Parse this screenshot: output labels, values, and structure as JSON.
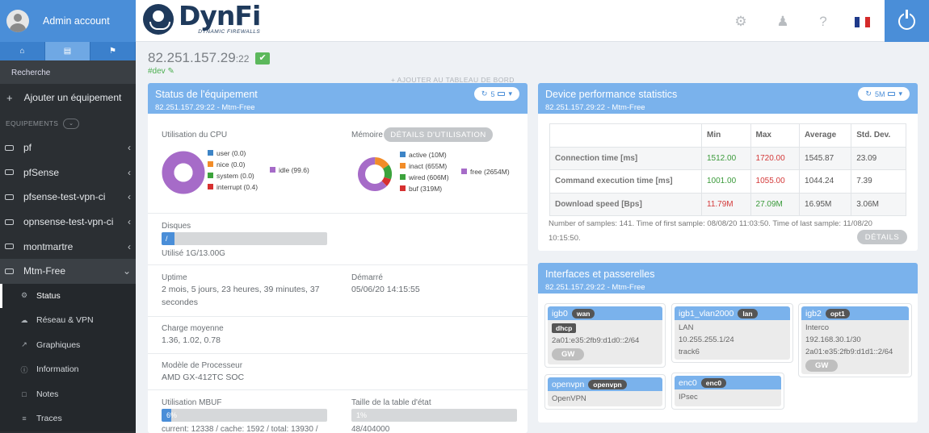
{
  "sidebar": {
    "user": "Admin account",
    "search": "Recherche",
    "add_label": "Ajouter un équipement",
    "section": "EQUIPEMENTS",
    "devices": [
      "pf",
      "pfSense",
      "pfsense-test-vpn-ci",
      "opnsense-test-vpn-ci",
      "montmartre",
      "Mtm-Free"
    ],
    "subitems": [
      "Status",
      "Réseau & VPN",
      "Graphiques",
      "Information",
      "Notes",
      "Traces"
    ]
  },
  "header": {
    "logo": "DynFi",
    "logo_sub": "DYNAMIC FIREWALLS",
    "flag_colors": [
      "#1f3a8a",
      "#ffffff",
      "#d42a2a"
    ]
  },
  "main": {
    "ip": "82.251.157.29",
    "port": ":22",
    "tag": "#dev",
    "add_dashboard": "+ AJOUTER AU TABLEAU DE BORD"
  },
  "status": {
    "title": "Status de l'équipement",
    "subtitle": "82.251.157.29:22 - Mtm-Free",
    "btn": "5",
    "cpu_label": "Utilisation du CPU",
    "cpu_legend": [
      "user (0.0)",
      "nice (0.0)",
      "system (0.0)",
      "interrupt (0.4)"
    ],
    "cpu_idle": "idle (99.6)",
    "mem_label": "Mémoire",
    "mem_btn": "DÉTAILS D'UTILISATION",
    "mem_legend": [
      "active (10M)",
      "inact (655M)",
      "wired (606M)",
      "buf (319M)"
    ],
    "mem_free": "free (2654M)",
    "disk_label": "Disques",
    "disk_bar": "/",
    "disk_used": "Utilisé 1G/13.00G",
    "disk_percent": 8,
    "uptime_label": "Uptime",
    "uptime_value": "2 mois, 5 jours, 23 heures, 39 minutes, 37 secondes",
    "started_label": "Démarré",
    "started_value": "05/06/20 14:15:55",
    "load_label": "Charge moyenne",
    "load_value": "1.36, 1.02, 0.78",
    "cpu_model_label": "Modèle de Processeur",
    "cpu_model_value": "AMD GX-412TC SOC",
    "mbuf_label": "Utilisation MBUF",
    "mbuf_bar": "6%",
    "mbuf_percent": 6,
    "mbuf_value": "current: 12338 / cache: 1592 / total: 13930 /",
    "state_label": "Taille de la table d'état",
    "state_bar": "1%",
    "state_value": "48/404000"
  },
  "perf": {
    "title": "Device performance statistics",
    "subtitle": "82.251.157.29:22 - Mtm-Free",
    "btn": "5M",
    "headers": [
      "",
      "Min",
      "Max",
      "Average",
      "Std. Dev."
    ],
    "rows": [
      [
        "Connection time [ms]",
        "1512.00",
        "1720.00",
        "1545.87",
        "23.09"
      ],
      [
        "Command execution time [ms]",
        "1001.00",
        "1055.00",
        "1044.24",
        "7.39"
      ],
      [
        "Download speed [Bps]",
        "11.79M",
        "27.09M",
        "16.95M",
        "3.06M"
      ]
    ],
    "note": "Number of samples: 141. Time of first sample: 08/08/20 11:03:50. Time of last sample: 11/08/20 10:15:50.",
    "details_btn": "DÉTAILS"
  },
  "ifaces": {
    "title": "Interfaces et passerelles",
    "subtitle": "82.251.157.29:22 - Mtm-Free",
    "cards": {
      "igb0": {
        "name": "igb0",
        "badge": "wan",
        "label": "dhcp",
        "lines": [
          "2a01:e35:2fb9:d1d0::2/64"
        ],
        "gw": "GW"
      },
      "igb1": {
        "name": "igb1_vlan2000",
        "badge": "lan",
        "lines": [
          "LAN",
          "10.255.255.1/24",
          "track6"
        ]
      },
      "igb2": {
        "name": "igb2",
        "badge": "opt1",
        "lines": [
          "Interco",
          "192.168.30.1/30",
          "2a01:e35:2fb9:d1d1::2/64"
        ],
        "gw": "GW"
      },
      "openvpn": {
        "name": "openvpn",
        "badge": "openvpn",
        "lines": [
          "OpenVPN"
        ]
      },
      "enc0": {
        "name": "enc0",
        "badge": "enc0",
        "lines": [
          "IPsec"
        ]
      }
    }
  }
}
